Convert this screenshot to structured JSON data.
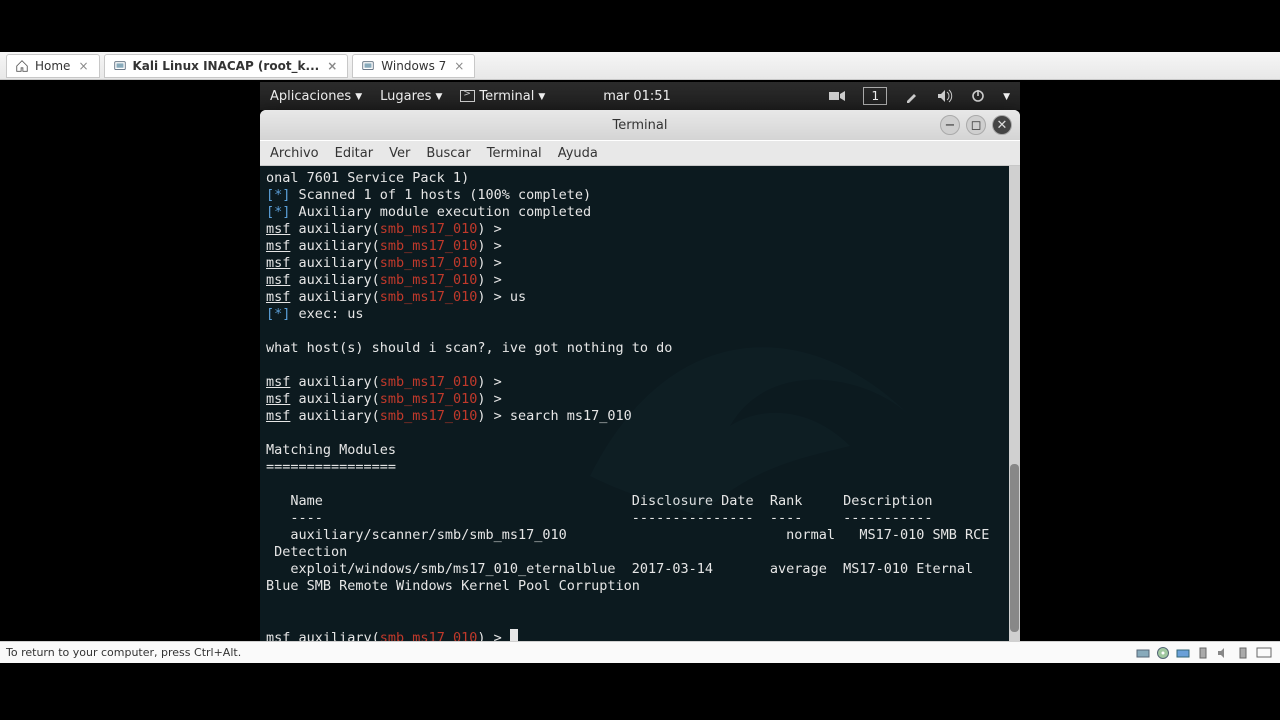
{
  "host_tabs": [
    {
      "label": "Home",
      "closable": true
    },
    {
      "label": "Kali Linux INACAP (root_k...",
      "closable": true
    },
    {
      "label": "Windows 7",
      "closable": true
    }
  ],
  "gnome": {
    "applications": "Aplicaciones",
    "places": "Lugares",
    "terminal": "Terminal",
    "clock": "mar 01:51",
    "workspace": "1"
  },
  "termwin": {
    "title": "Terminal",
    "menus": [
      "Archivo",
      "Editar",
      "Ver",
      "Buscar",
      "Terminal",
      "Ayuda"
    ]
  },
  "term": {
    "frag1": "onal 7601 Service Pack 1)",
    "scan": "Scanned 1 of 1 hosts (100% complete)",
    "aux_complete": "Auxiliary module execution completed",
    "star": "[*]",
    "msf": "msf",
    "aux_pre": " auxiliary(",
    "module": "smb_ms17_010",
    "aux_post": ") > ",
    "cmd_us": "us",
    "exec_us": "exec: us",
    "nothing": "what host(s) should i scan?, ive got nothing to do",
    "cmd_search": "search ms17_010",
    "matching": "Matching Modules",
    "matching_u": "================",
    "hdr_name": "   Name                                      Disclosure Date  Rank     Description",
    "hdr_dash": "   ----                                      ---------------  ----     -----------",
    "row1": "   auxiliary/scanner/smb/smb_ms17_010                           normal   MS17-010 SMB RCE",
    "row1b": " Detection",
    "row2": "   exploit/windows/smb/ms17_010_eternalblue  2017-03-14       average  MS17-010 Eternal",
    "row2b": "Blue SMB Remote Windows Kernel Pool Corruption"
  },
  "host_status": "To return to your computer, press Ctrl+Alt."
}
